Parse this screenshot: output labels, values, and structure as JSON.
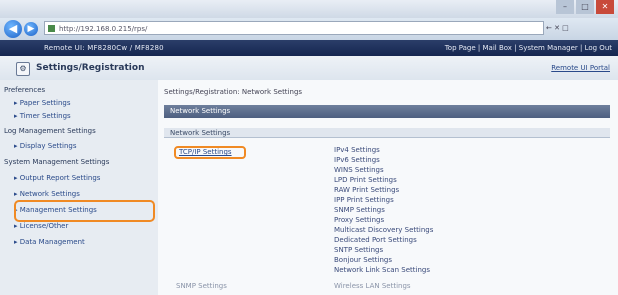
{
  "browser": {
    "url": "http://192.168.0.215/rps/",
    "search_hint": "← ✕ □",
    "window_controls": [
      "–",
      "□",
      "✕"
    ]
  },
  "header": {
    "app_title": "Remote UI: MF8280Cw / MF8280",
    "top_links": "Top Page | Mail Box | System Manager | Log Out"
  },
  "page": {
    "title": "Settings/Registration",
    "portal_link": "Remote UI Portal"
  },
  "sidebar": {
    "items": [
      {
        "label": "Preferences",
        "level": 0
      },
      {
        "label": "▸ Paper Settings",
        "level": 1
      },
      {
        "label": "▸ Timer Settings",
        "level": 1
      },
      {
        "label": "Log Management Settings",
        "level": 0
      },
      {
        "label": "▸ Display Settings",
        "level": 1
      },
      {
        "label": "System Management Settings",
        "level": 0
      },
      {
        "label": "▸ Output Report Settings",
        "level": 1
      },
      {
        "label": "▸ Network Settings",
        "level": 1
      },
      {
        "label": "▸ Management Settings",
        "level": 1
      },
      {
        "label": "▸ License/Other",
        "level": 1
      },
      {
        "label": "▸ Data Management",
        "level": 1
      }
    ]
  },
  "main": {
    "intro": "Settings/Registration: Network Settings",
    "band": "Network Settings",
    "section": "Network Settings",
    "left_link": "TCP/IP Settings",
    "right_links": [
      "IPv4 Settings",
      "IPv6 Settings",
      "WINS Settings",
      "LPD Print Settings",
      "RAW Print Settings",
      "IPP Print Settings",
      "SNMP Settings",
      "Proxy Settings",
      "Multicast Discovery Settings",
      "Dedicated Port Settings",
      "SNTP Settings",
      "Bonjour Settings",
      "Network Link Scan Settings"
    ],
    "bottom_left": "SNMP Settings",
    "bottom_right": "Wireless LAN Settings"
  }
}
